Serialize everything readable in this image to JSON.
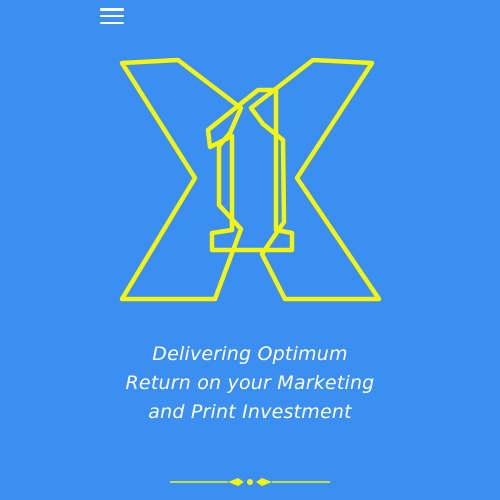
{
  "header": {
    "menu_icon": "hamburger-menu-icon"
  },
  "logo": {
    "icon": "x1-outline-logo",
    "stroke_color": "#f5f50a",
    "background_color": "#3b8ef2"
  },
  "hero": {
    "tagline_lines": [
      "Delivering Optimum",
      "Return on your Marketing",
      "and Print Investment"
    ]
  },
  "divider": {
    "icon": "ornamental-divider-icon",
    "color": "#f5f50a"
  }
}
